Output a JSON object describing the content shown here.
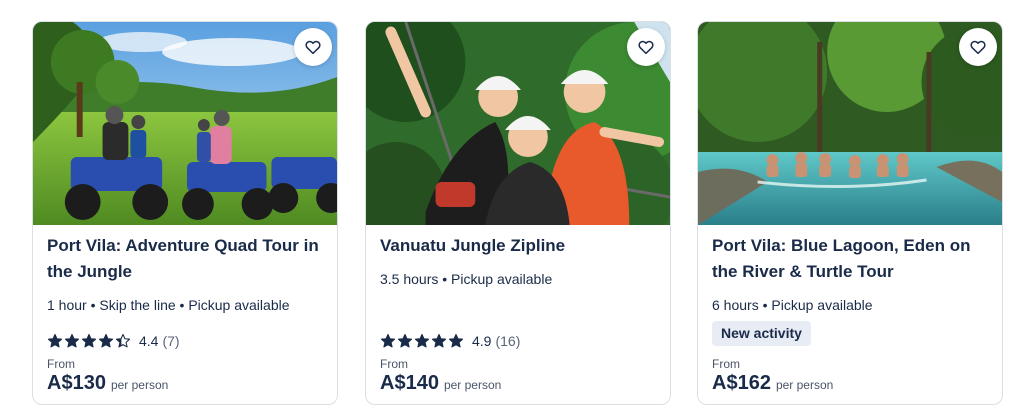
{
  "cards": [
    {
      "title": "Port Vila: Adventure Quad Tour in the Jungle",
      "meta": "1 hour • Skip the line • Pickup available",
      "rating_value": "4.4",
      "rating_count": "(7)",
      "rating_stars": 4.4,
      "from_label": "From",
      "price": "A$130",
      "per_label": "per person",
      "image_icon": "quad-bike-photo"
    },
    {
      "title": "Vanuatu Jungle Zipline",
      "meta": "3.5 hours • Pickup available",
      "rating_value": "4.9",
      "rating_count": "(16)",
      "rating_stars": 4.9,
      "from_label": "From",
      "price": "A$140",
      "per_label": "per person",
      "image_icon": "zipline-photo"
    },
    {
      "title": "Port Vila: Blue Lagoon, Eden on the River & Turtle Tour",
      "meta": "6 hours • Pickup available",
      "badge": "New activity",
      "from_label": "From",
      "price": "A$162",
      "per_label": "per person",
      "image_icon": "lagoon-photo"
    }
  ],
  "icons": {
    "wishlist": "heart-outline-icon",
    "star": "star-icon"
  },
  "colors": {
    "text": "#1a2b49",
    "badge_bg": "#e8edf5",
    "border": "#dcdfe4"
  }
}
